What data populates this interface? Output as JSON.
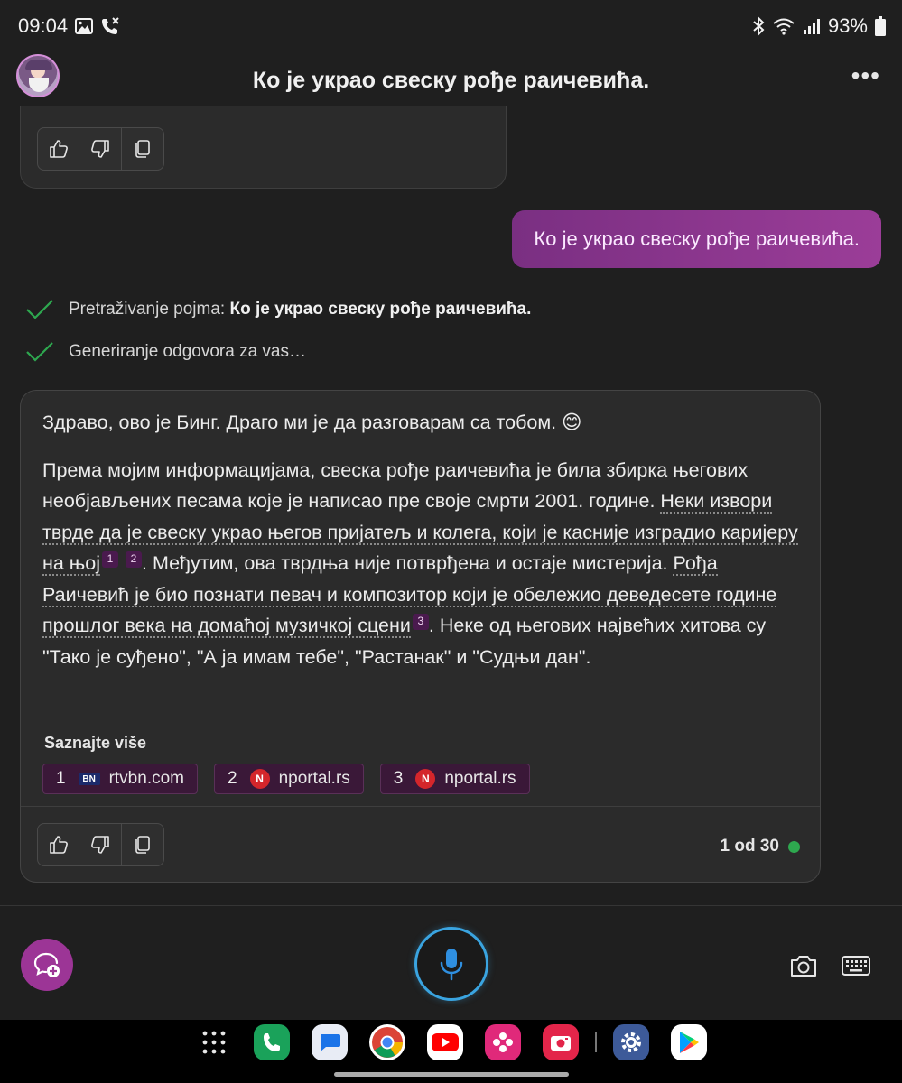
{
  "status_bar": {
    "time": "09:04",
    "battery": "93%"
  },
  "header": {
    "title": "Ко је украо свеску рође раичевића.",
    "more": "•••"
  },
  "conversation": {
    "user_message": "Ко је украо свеску рође раичевића.",
    "progress": [
      {
        "label": "Pretraživanje pojma:",
        "value": "Ко је украо свеску рође раичевића."
      },
      {
        "label": "Generiranje odgovora za vas…",
        "value": ""
      }
    ],
    "answer": {
      "greeting": "Здраво, ово је Бинг. Драго ми је да разговарам са тобом. 😊",
      "p1_a": "Према мојим информацијама, свеска рође раичевића је била збирка његових необјављених песама које је написао пре своје смрти 2001. године. ",
      "p1_ref1": "Неки извори тврде да је свеску украо његов пријатељ и колега, који је касније изградио каријеру на њој",
      "sup1": "1",
      "sup2": "2",
      "p1_b": ". Међутим, ова тврдња није потврђена и остаје мистерија. ",
      "p1_ref2": "Рођа Раичевић је био познати певач и композитор који је обележио деведесете године прошлог века на домаћој музичкој сцени",
      "sup3": "3",
      "p1_c": ". Неке од његових највећих хитова су \"Тако је суђено\", \"А ја имам тебе\", \"Растанак\" и \"Судњи дан\".",
      "learn_more": "Saznajte više",
      "sources": [
        {
          "num": "1",
          "domain": "rtvbn.com",
          "icon": "BN"
        },
        {
          "num": "2",
          "domain": "nportal.rs",
          "icon": "N"
        },
        {
          "num": "3",
          "domain": "nportal.rs",
          "icon": "N"
        }
      ],
      "counter": "1 od 30"
    }
  },
  "colors": {
    "accent": "#9c3596",
    "mic_ring": "#3aa4e0",
    "online_dot": "#2ea84f"
  }
}
